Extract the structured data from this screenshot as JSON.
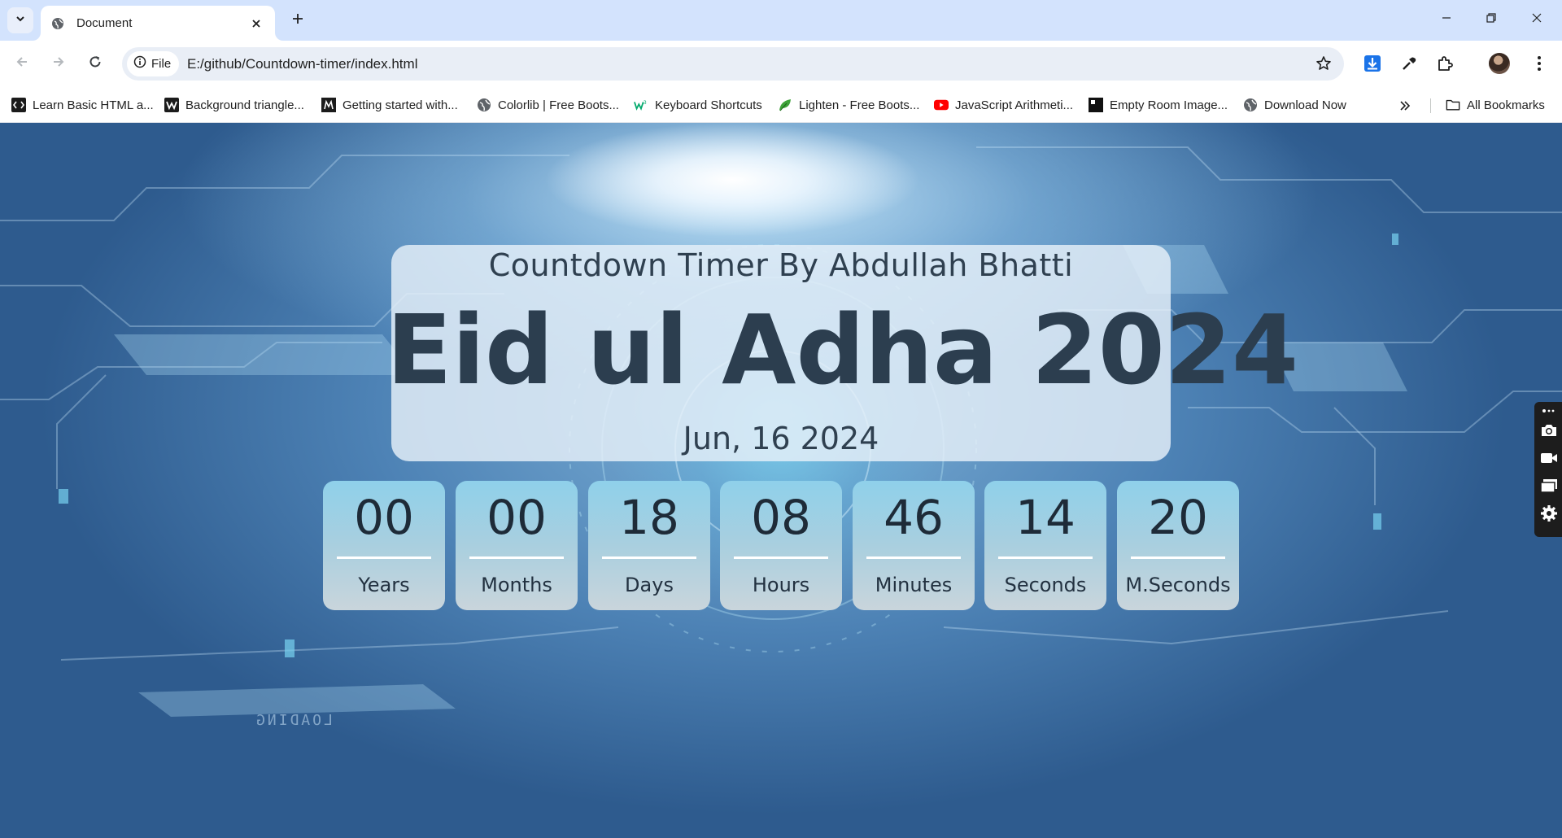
{
  "browser": {
    "tab_title": "Document",
    "site_chip_label": "File",
    "url": "E:/github/Countdown-timer/index.html",
    "bookmarks": [
      {
        "label": "Learn Basic HTML a...",
        "icon": "code-bracket-icon"
      },
      {
        "label": "Background triangle...",
        "icon": "w-logo-icon"
      },
      {
        "label": "Getting started with...",
        "icon": "m-logo-icon"
      },
      {
        "label": "Colorlib | Free Boots...",
        "icon": "globe-icon"
      },
      {
        "label": "Keyboard Shortcuts",
        "icon": "w3-logo-icon"
      },
      {
        "label": "Lighten - Free Boots...",
        "icon": "green-leaf-icon"
      },
      {
        "label": "JavaScript Arithmeti...",
        "icon": "youtube-icon"
      },
      {
        "label": "Empty Room Image...",
        "icon": "black-square-icon"
      },
      {
        "label": "Download Now",
        "icon": "globe-icon"
      }
    ],
    "all_bookmarks_label": "All Bookmarks"
  },
  "page": {
    "subtitle": "Countdown Timer By Abdullah Bhatti",
    "event": "Eid ul Adha 2024",
    "date": "Jun, 16 2024",
    "units": [
      {
        "value": "00",
        "label": "Years"
      },
      {
        "value": "00",
        "label": "Months"
      },
      {
        "value": "18",
        "label": "Days"
      },
      {
        "value": "08",
        "label": "Hours"
      },
      {
        "value": "46",
        "label": "Minutes"
      },
      {
        "value": "14",
        "label": "Seconds"
      },
      {
        "value": "20",
        "label": "M.Seconds"
      }
    ],
    "background_overlay_text": "LOADING"
  },
  "colors": {
    "tabstrip": "#d3e3fd",
    "card_text": "#2c3e4f",
    "unit_box_top": "#8fd0ea",
    "unit_box_bottom": "#c9d5dc"
  }
}
